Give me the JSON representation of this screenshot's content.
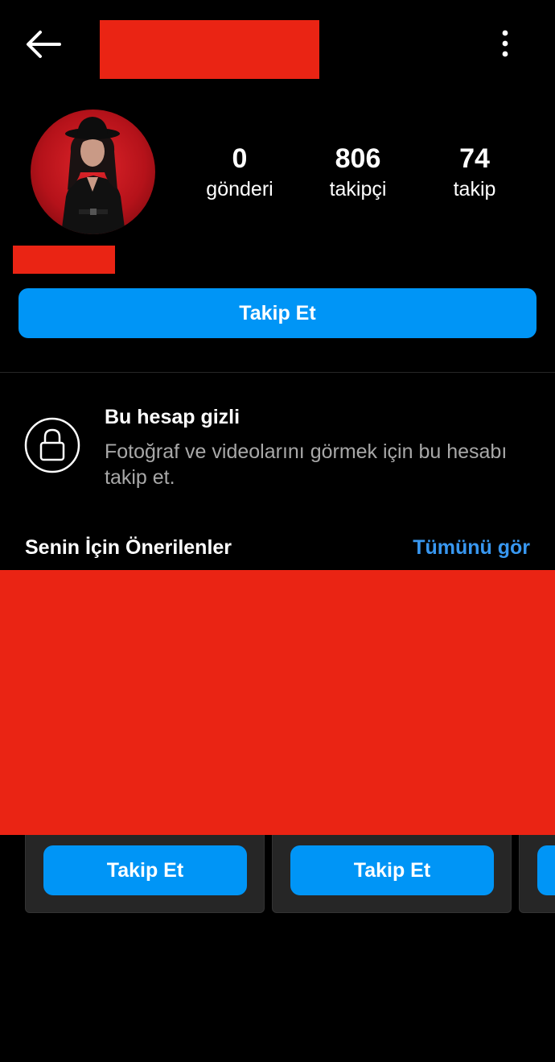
{
  "colors": {
    "background": "#000000",
    "primary_button": "#0095f6",
    "link": "#3897f0",
    "secondary_text": "#a8a8a8",
    "redaction": "#ea2414"
  },
  "icons": {
    "back": "arrow-left-icon",
    "more": "more-vertical-icon",
    "lock": "lock-icon"
  },
  "profile": {
    "stats": {
      "posts": {
        "value": "0",
        "label": "gönderi"
      },
      "followers": {
        "value": "806",
        "label": "takipçi"
      },
      "following": {
        "value": "74",
        "label": "takip"
      }
    },
    "follow_label": "Takip Et"
  },
  "private_account": {
    "title": "Bu hesap gizli",
    "description": "Fotoğraf ve videolarını görmek için bu hesabı takip et."
  },
  "suggestions": {
    "title": "Senin İçin Önerilenler",
    "see_all": "Tümünü gör",
    "cards": [
      {
        "follow_label": "Takip Et"
      },
      {
        "follow_label": "Takip Et"
      },
      {
        "follow_label": ""
      }
    ]
  }
}
